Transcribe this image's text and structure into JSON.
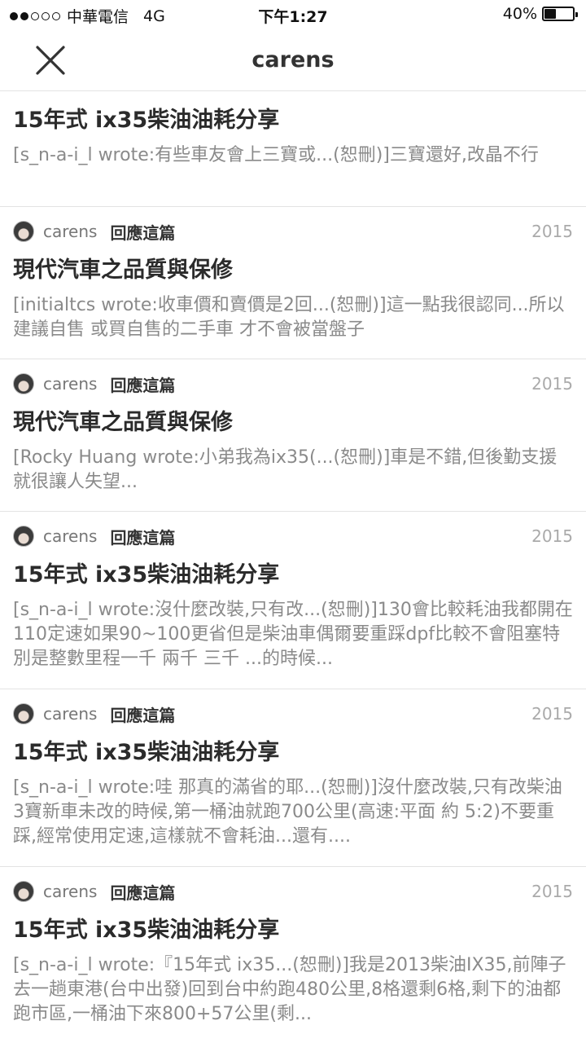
{
  "status_bar": {
    "carrier": "中華電信",
    "network": "4G",
    "time": "下午1:27",
    "battery": "40%",
    "battery_level": 0.4
  },
  "header": {
    "title": "carens",
    "close_icon": "close-icon"
  },
  "posts": [
    {
      "title": "15年式 ix35柴油油耗分享",
      "excerpt": "[s_n-a-i_l wrote:有些車友會上三寶或...(恕刪)]三寶還好,改晶不行"
    },
    {
      "author": "carens",
      "reply_label": "回應這篇",
      "year": "2015",
      "title": "現代汽車之品質與保修",
      "excerpt": "[initialtcs wrote:收車價和賣價是2回...(恕刪)]這一點我很認同...所以建議自售 或買自售的二手車 才不會被當盤子"
    },
    {
      "author": "carens",
      "reply_label": "回應這篇",
      "year": "2015",
      "title": "現代汽車之品質與保修",
      "excerpt": "[Rocky Huang wrote:小弟我為ix35(...(恕刪)]車是不錯,但後勤支援就很讓人失望..."
    },
    {
      "author": "carens",
      "reply_label": "回應這篇",
      "year": "2015",
      "title": "15年式 ix35柴油油耗分享",
      "excerpt": "[s_n-a-i_l wrote:沒什麼改裝,只有改...(恕刪)]130會比較耗油我都開在110定速如果90~100更省但是柴油車偶爾要重踩dpf比較不會阻塞特別是整數里程一千 兩千 三千 ...的時候..."
    },
    {
      "author": "carens",
      "reply_label": "回應這篇",
      "year": "2015",
      "title": "15年式 ix35柴油油耗分享",
      "excerpt": "[s_n-a-i_l wrote:哇 那真的滿省的耶...(恕刪)]沒什麼改裝,只有改柴油3寶新車未改的時候,第一桶油就跑700公里(高速:平面 約 5:2)不要重踩,經常使用定速,這樣就不會耗油...還有...."
    },
    {
      "author": "carens",
      "reply_label": "回應這篇",
      "year": "2015",
      "title": "15年式 ix35柴油油耗分享",
      "excerpt": "[s_n-a-i_l wrote:『15年式 ix35...(恕刪)]我是2013柴油IX35,前陣子去一趟東港(台中出發)回到台中約跑480公里,8格還剩6格,剩下的油都跑市區,一桶油下來800+57公里(剩..."
    }
  ]
}
